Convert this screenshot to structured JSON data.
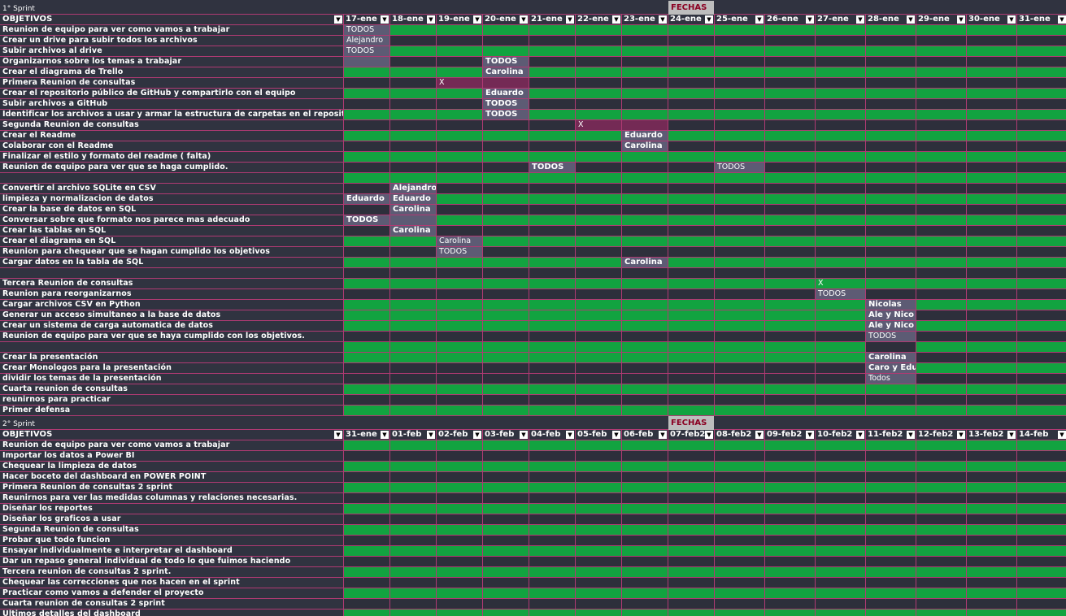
{
  "sprint1": {
    "title": "1° Sprint",
    "fechas_label": "FECHAS",
    "objetivos_label": "OBJETIVOS",
    "dates": [
      "17-ene",
      "18-ene",
      "19-ene",
      "20-ene",
      "21-ene",
      "22-ene",
      "23-ene",
      "24-ene",
      "25-ene",
      "26-ene",
      "27-ene",
      "28-ene",
      "29-ene",
      "30-ene",
      "31-ene"
    ],
    "rows": [
      {
        "label": "Reunion de equipo para ver como vamos a trabajar",
        "cells": [
          [
            "b",
            "TODOS"
          ]
        ]
      },
      {
        "label": "Crear un drive para subir todos los archivos",
        "cells": [
          [
            "b",
            "Alejandro"
          ]
        ]
      },
      {
        "label": "Subir archivos al drive",
        "cells": [
          [
            "b",
            "TODOS"
          ]
        ]
      },
      {
        "label": "Organizarnos sobre los temas a trabajar",
        "cells": [
          [
            "b",
            ""
          ],
          [
            "d",
            ""
          ],
          [
            "d",
            ""
          ],
          [
            "bb",
            "TODOS"
          ]
        ]
      },
      {
        "label": "Crear el diagrama de Trello",
        "cells": [
          [
            "g",
            ""
          ],
          [
            "g",
            ""
          ],
          [
            "g",
            ""
          ],
          [
            "bb",
            "Carolina"
          ]
        ]
      },
      {
        "label": "Primera Reunion de consultas",
        "cells": [
          [
            "d",
            ""
          ],
          [
            "d",
            ""
          ],
          [
            "m",
            "X"
          ],
          [
            "m",
            ""
          ]
        ]
      },
      {
        "label": "Crear el repositorio público de GitHub  y compartirlo con el equipo",
        "cells": [
          [
            "g",
            ""
          ],
          [
            "g",
            ""
          ],
          [
            "g",
            ""
          ],
          [
            "bb",
            "Eduardo"
          ]
        ]
      },
      {
        "label": "Subir archivos a GitHub",
        "cells": [
          [
            "d",
            ""
          ],
          [
            "d",
            ""
          ],
          [
            "d",
            ""
          ],
          [
            "bb",
            "TODOS"
          ]
        ]
      },
      {
        "label": "Identificar los archivos a usar y armar la estructura de carpetas en el repositorio",
        "cells": [
          [
            "g",
            ""
          ],
          [
            "g",
            ""
          ],
          [
            "g",
            ""
          ],
          [
            "bb",
            "TODOS"
          ]
        ]
      },
      {
        "label": "Segunda Reunion de consultas",
        "cells": [
          [
            "d",
            ""
          ],
          [
            "d",
            ""
          ],
          [
            "d",
            ""
          ],
          [
            "d",
            ""
          ],
          [
            "d",
            ""
          ],
          [
            "m",
            "X"
          ],
          [
            "m",
            ""
          ]
        ]
      },
      {
        "label": "Crear el Readme",
        "cells": [
          [
            "g",
            ""
          ],
          [
            "g",
            ""
          ],
          [
            "g",
            ""
          ],
          [
            "g",
            ""
          ],
          [
            "g",
            ""
          ],
          [
            "g",
            ""
          ],
          [
            "bb",
            "Eduardo"
          ]
        ]
      },
      {
        "label": "Colaborar con el Readme",
        "cells": [
          [
            "d",
            ""
          ],
          [
            "d",
            ""
          ],
          [
            "d",
            ""
          ],
          [
            "d",
            ""
          ],
          [
            "d",
            ""
          ],
          [
            "d",
            ""
          ],
          [
            "bb",
            "Carolina"
          ]
        ]
      },
      {
        "label": "Finalizar el estilo y formato del readme  ( falta)",
        "cells": []
      },
      {
        "label": "Reunion de equipo para ver que se haga cumplido.",
        "cells": [
          [
            "d",
            ""
          ],
          [
            "d",
            ""
          ],
          [
            "d",
            ""
          ],
          [
            "d",
            ""
          ],
          [
            "bb",
            "TODOS"
          ],
          [
            "d",
            ""
          ],
          [
            "d",
            ""
          ],
          [
            "d",
            ""
          ],
          [
            "b",
            "TODOS"
          ]
        ]
      },
      {
        "label": "",
        "cells": []
      },
      {
        "label": "Convertir el archivo SQLite en CSV",
        "cells": [
          [
            "d",
            ""
          ],
          [
            "bb",
            "Alejandro"
          ]
        ]
      },
      {
        "label": "limpieza y normalizacion de datos",
        "cells": [
          [
            "bb",
            "Eduardo"
          ],
          [
            "bb",
            "Eduardo"
          ]
        ]
      },
      {
        "label": "Crear la base de datos en SQL",
        "cells": [
          [
            "d",
            ""
          ],
          [
            "bb",
            "Carolina"
          ]
        ]
      },
      {
        "label": "Conversar sobre que formato nos parece mas adecuado",
        "cells": [
          [
            "bb",
            "TODOS"
          ],
          [
            "b",
            ""
          ]
        ]
      },
      {
        "label": "Crear las tablas en SQL",
        "cells": [
          [
            "d",
            ""
          ],
          [
            "bb",
            "Carolina"
          ]
        ]
      },
      {
        "label": "Crear el diagrama en SQL",
        "cells": [
          [
            "g",
            ""
          ],
          [
            "g",
            ""
          ],
          [
            "b",
            "Carolina"
          ]
        ]
      },
      {
        "label": "Reunion para chequear que se hagan cumplido los objetivos",
        "cells": [
          [
            "d",
            ""
          ],
          [
            "d",
            ""
          ],
          [
            "b",
            "TODOS"
          ]
        ]
      },
      {
        "label": "Cargar datos en la tabla de SQL",
        "cells": [
          [
            "g",
            ""
          ],
          [
            "g",
            ""
          ],
          [
            "g",
            ""
          ],
          [
            "g",
            ""
          ],
          [
            "g",
            ""
          ],
          [
            "g",
            ""
          ],
          [
            "bb",
            "Carolina"
          ]
        ]
      },
      {
        "label": "",
        "cells": []
      },
      {
        "label": "Tercera Reunion de consultas",
        "cells": [
          [
            "g",
            ""
          ],
          [
            "g",
            ""
          ],
          [
            "g",
            ""
          ],
          [
            "g",
            ""
          ],
          [
            "g",
            ""
          ],
          [
            "g",
            ""
          ],
          [
            "g",
            ""
          ],
          [
            "g",
            ""
          ],
          [
            "g",
            ""
          ],
          [
            "g",
            ""
          ],
          [
            "g",
            "X"
          ]
        ]
      },
      {
        "label": "Reunion para reorganizarnos",
        "cells": [
          [
            "d",
            ""
          ],
          [
            "d",
            ""
          ],
          [
            "d",
            ""
          ],
          [
            "d",
            ""
          ],
          [
            "d",
            ""
          ],
          [
            "d",
            ""
          ],
          [
            "d",
            ""
          ],
          [
            "d",
            ""
          ],
          [
            "d",
            ""
          ],
          [
            "d",
            ""
          ],
          [
            "b",
            "TODOS"
          ]
        ]
      },
      {
        "label": "Cargar archivos CSV  en Python",
        "cells": [
          [
            "g",
            ""
          ],
          [
            "g",
            ""
          ],
          [
            "g",
            ""
          ],
          [
            "g",
            ""
          ],
          [
            "g",
            ""
          ],
          [
            "g",
            ""
          ],
          [
            "g",
            ""
          ],
          [
            "g",
            ""
          ],
          [
            "g",
            ""
          ],
          [
            "g",
            ""
          ],
          [
            "g",
            ""
          ],
          [
            "bb",
            "Nicolas"
          ]
        ]
      },
      {
        "label": "Generar un acceso simultaneo a la base de datos",
        "cells": [
          [
            "g",
            ""
          ],
          [
            "g",
            ""
          ],
          [
            "g",
            ""
          ],
          [
            "g",
            ""
          ],
          [
            "g",
            ""
          ],
          [
            "g",
            ""
          ],
          [
            "g",
            ""
          ],
          [
            "g",
            ""
          ],
          [
            "g",
            ""
          ],
          [
            "g",
            ""
          ],
          [
            "g",
            ""
          ],
          [
            "bb",
            "Ale y Nico"
          ]
        ]
      },
      {
        "label": "Crear un sistema de carga automatica de datos",
        "cells": [
          [
            "g",
            ""
          ],
          [
            "g",
            ""
          ],
          [
            "g",
            ""
          ],
          [
            "g",
            ""
          ],
          [
            "g",
            ""
          ],
          [
            "g",
            ""
          ],
          [
            "g",
            ""
          ],
          [
            "g",
            ""
          ],
          [
            "g",
            ""
          ],
          [
            "g",
            ""
          ],
          [
            "g",
            ""
          ],
          [
            "bb",
            "Ale y Nico"
          ]
        ]
      },
      {
        "label": "Reunion de equipo para ver que se haya cumplido con los objetivos.",
        "cells": [
          [
            "d",
            ""
          ],
          [
            "d",
            ""
          ],
          [
            "d",
            ""
          ],
          [
            "d",
            ""
          ],
          [
            "d",
            ""
          ],
          [
            "d",
            ""
          ],
          [
            "d",
            ""
          ],
          [
            "d",
            ""
          ],
          [
            "d",
            ""
          ],
          [
            "d",
            ""
          ],
          [
            "d",
            ""
          ],
          [
            "b",
            "TODOS"
          ]
        ]
      },
      {
        "label": "",
        "cells": [
          [
            "g",
            ""
          ],
          [
            "g",
            ""
          ],
          [
            "g",
            ""
          ],
          [
            "g",
            ""
          ],
          [
            "g",
            ""
          ],
          [
            "g",
            ""
          ],
          [
            "g",
            ""
          ],
          [
            "g",
            ""
          ],
          [
            "g",
            ""
          ],
          [
            "g",
            ""
          ],
          [
            "g",
            ""
          ],
          [
            "d",
            ""
          ]
        ]
      },
      {
        "label": "Crear la presentación",
        "cells": [
          [
            "g",
            ""
          ],
          [
            "g",
            ""
          ],
          [
            "g",
            ""
          ],
          [
            "g",
            ""
          ],
          [
            "g",
            ""
          ],
          [
            "g",
            ""
          ],
          [
            "g",
            ""
          ],
          [
            "g",
            ""
          ],
          [
            "g",
            ""
          ],
          [
            "g",
            ""
          ],
          [
            "g",
            ""
          ],
          [
            "bb",
            "Carolina"
          ]
        ]
      },
      {
        "label": "Crear Monologos para la presentación",
        "cells": [
          [
            "d",
            ""
          ],
          [
            "d",
            ""
          ],
          [
            "d",
            ""
          ],
          [
            "d",
            ""
          ],
          [
            "d",
            ""
          ],
          [
            "d",
            ""
          ],
          [
            "d",
            ""
          ],
          [
            "d",
            ""
          ],
          [
            "d",
            ""
          ],
          [
            "d",
            ""
          ],
          [
            "d",
            ""
          ],
          [
            "bb",
            "Caro y Edu"
          ]
        ]
      },
      {
        "label": "dividir los temas de la presentación",
        "cells": [
          [
            "d",
            ""
          ],
          [
            "d",
            ""
          ],
          [
            "d",
            ""
          ],
          [
            "d",
            ""
          ],
          [
            "d",
            ""
          ],
          [
            "d",
            ""
          ],
          [
            "d",
            ""
          ],
          [
            "d",
            ""
          ],
          [
            "d",
            ""
          ],
          [
            "d",
            ""
          ],
          [
            "d",
            ""
          ],
          [
            "b",
            "Todos"
          ]
        ]
      },
      {
        "label": "Cuarta  reunion de consultas",
        "cells": []
      },
      {
        "label": "reunirnos para practicar",
        "cells": []
      },
      {
        "label": "Primer defensa",
        "cells": []
      }
    ]
  },
  "sprint2": {
    "title": "2° Sprint",
    "fechas_label": "FECHAS",
    "objetivos_label": "OBJETIVOS",
    "dates": [
      "31-ene",
      "01-feb",
      "02-feb",
      "03-feb",
      "04-feb",
      "05-feb",
      "06-feb",
      "07-feb2",
      "08-feb2",
      "09-feb2",
      "10-feb2",
      "11-feb2",
      "12-feb2",
      "13-feb2",
      "14-feb"
    ],
    "rows": [
      {
        "label": "Reunion de equipo para ver como vamos a trabajar"
      },
      {
        "label": "Importar los datos a Power BI"
      },
      {
        "label": "Chequear la limpieza de datos"
      },
      {
        "label": "Hacer boceto  del dashboard en POWER POINT"
      },
      {
        "label": "Primera Reunion de consultas 2 sprint"
      },
      {
        "label": "Reunirnos para ver las medidas columnas y relaciones necesarias."
      },
      {
        "label": "Diseñar los reportes"
      },
      {
        "label": "Diseñar los graficos a usar"
      },
      {
        "label": "Segunda Reunion de consultas"
      },
      {
        "label": "Probar que todo funcion"
      },
      {
        "label": "Ensayar individualmente e interpretar el dashboard"
      },
      {
        "label": "Dar un repaso general individual de todo lo que fuimos haciendo"
      },
      {
        "label": "Tercera reunion de consultas 2 sprint."
      },
      {
        "label": "Chequear las correcciones que nos hacen en el sprint"
      },
      {
        "label": "Practicar como vamos a defender el proyecto"
      },
      {
        "label": "Cuarta reunion de consultas 2 sprint"
      },
      {
        "label": "Ultimos detalles del dashboard"
      }
    ]
  },
  "colors": {
    "green": "#12a340",
    "dark": "#2d2f3b",
    "assign": "#5d5b74",
    "meeting": "#742a55",
    "grid": "#b03a73",
    "fechas_bg": "#bdbdbd",
    "fechas_text": "#8b0022"
  },
  "icons": {
    "dropdown": "filter-dropdown-icon"
  }
}
